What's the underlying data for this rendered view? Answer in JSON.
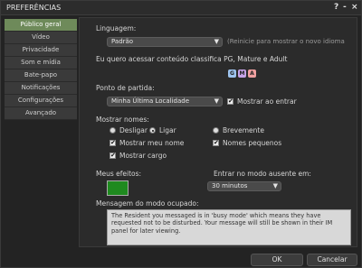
{
  "window": {
    "title": "PREFERÊNCIAS",
    "help_glyph": "?",
    "minimize_glyph": "-",
    "close_glyph": "×"
  },
  "sidebar": {
    "items": [
      {
        "label": "Público geral"
      },
      {
        "label": "Vídeo"
      },
      {
        "label": "Privacidade"
      },
      {
        "label": "Som e mídia"
      },
      {
        "label": "Bate-papo"
      },
      {
        "label": "Notificações"
      },
      {
        "label": "Configurações"
      },
      {
        "label": "Avançado"
      }
    ]
  },
  "language": {
    "label": "Linguagem:",
    "value": "Padrão",
    "hint": "(Reinicie para mostrar o novo idioma"
  },
  "content": {
    "label": "Eu quero acessar conteúdo classifica  PG, Mature e Adult",
    "badges": [
      {
        "letter": "G",
        "color": "#9ec4ef"
      },
      {
        "letter": "M",
        "color": "#c6a3e8"
      },
      {
        "letter": "A",
        "color": "#f0a0a0"
      }
    ]
  },
  "start": {
    "label": "Ponto de partida:",
    "value": "Minha Última Localidade",
    "show_on_login_label": "Mostrar ao entrar",
    "show_on_login_checked": true
  },
  "names": {
    "label": "Mostrar nomes:",
    "options": [
      {
        "label": "Desligar",
        "selected": false
      },
      {
        "label": "Ligar",
        "selected": true
      },
      {
        "label": "Brevemente",
        "selected": false
      }
    ],
    "my_name_label": "Mostrar meu nome",
    "my_name_checked": true,
    "small_names_label": "Nomes pequenos",
    "small_names_checked": true,
    "show_title_label": "Mostrar cargo",
    "show_title_checked": true
  },
  "effects": {
    "label": "Meus efeitos:",
    "color": "#1f8a1f"
  },
  "away": {
    "label": "Entrar no modo ausente em:",
    "value": "30 minutos"
  },
  "busy": {
    "label": "Mensagem do modo ocupado:",
    "message": "The Resident you messaged is in 'busy mode' which means they have requested not to be disturbed.  Your message will still be shown in their IM panel for later viewing."
  },
  "footer": {
    "ok_label": "OK",
    "cancel_label": "Cancelar"
  },
  "icons": {
    "dropdown": "chevron-down-icon",
    "check": "✔"
  }
}
